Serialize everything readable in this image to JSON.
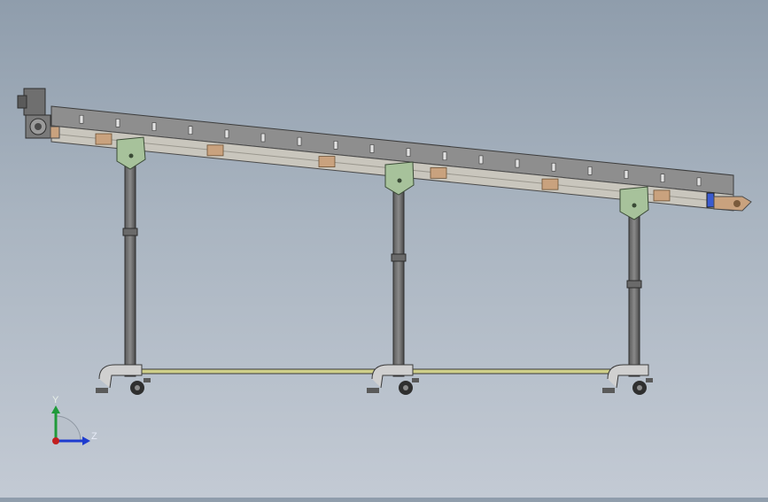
{
  "view": {
    "background_top": "#8f9dac",
    "background_bottom": "#c3cad4"
  },
  "triad": {
    "y_label": "Y",
    "z_label": "Z",
    "y_color": "#1f9a3a",
    "z_color": "#1e3ccf",
    "x_color": "#c21f1f"
  },
  "model": {
    "frame_color": "#9a9a9a",
    "bracket_color": "#a7c29b",
    "pad_color": "#c9a27e",
    "caster_color": "#3a3a3a",
    "rail_color": "#cfcf8a"
  }
}
